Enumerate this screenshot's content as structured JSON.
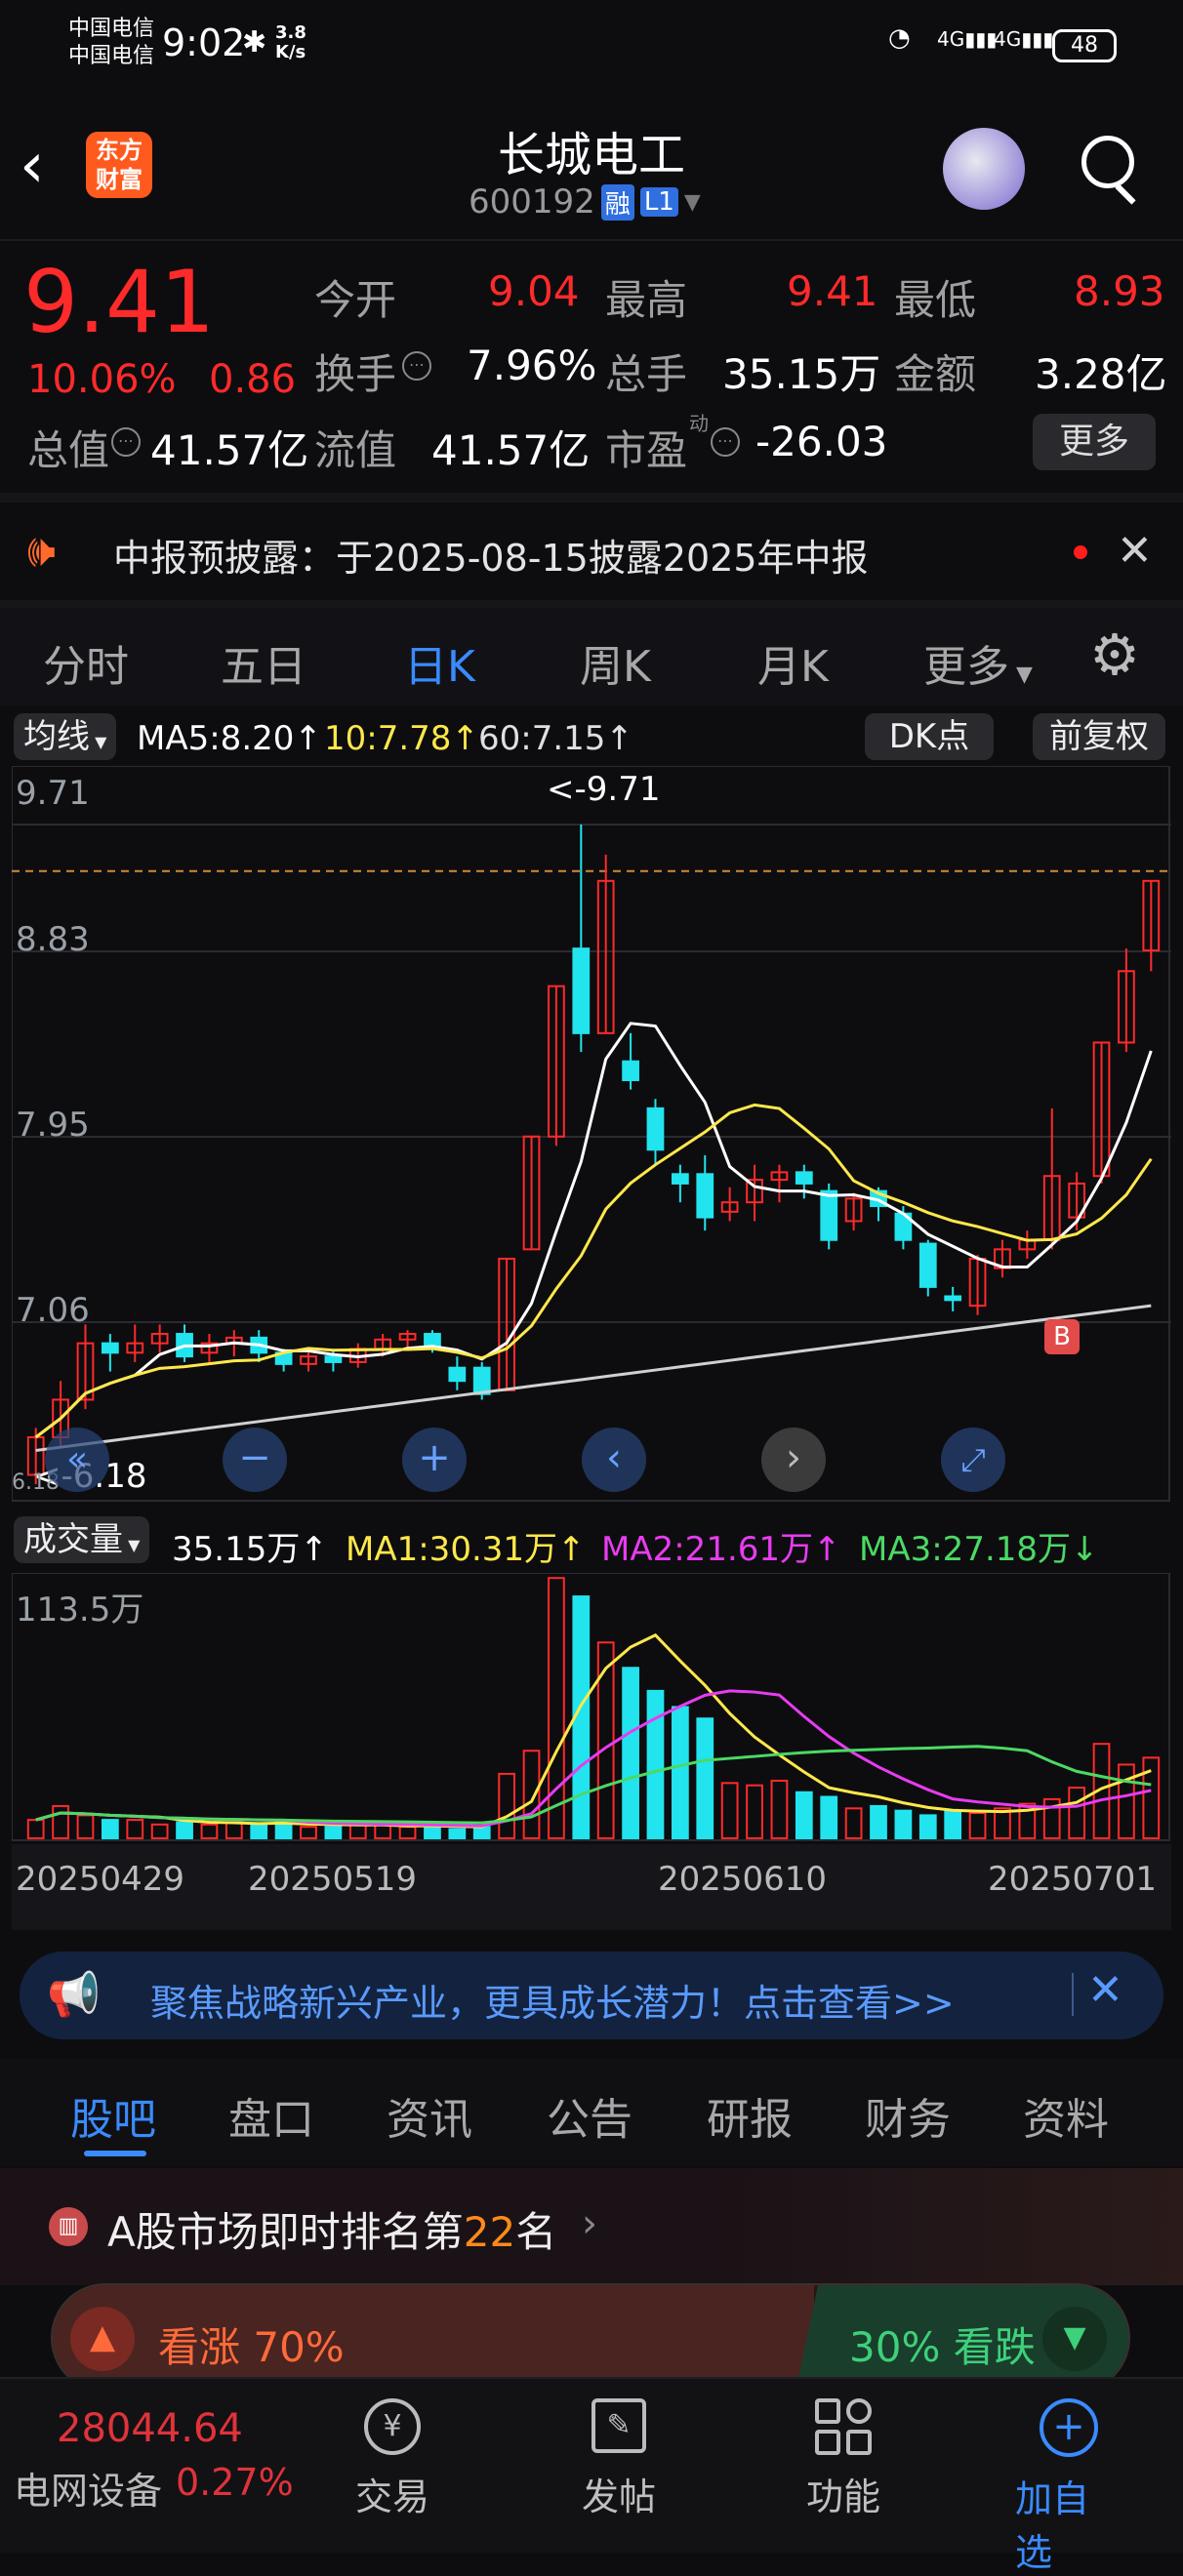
{
  "status_bar": {
    "carrier1": "中国电信",
    "carrier2": "中国电信",
    "time": "9:02",
    "speed_top": "3.8",
    "speed_bottom": "K/s",
    "battery": "48"
  },
  "header": {
    "logo_line1": "东方",
    "logo_line2": "财富",
    "title": "长城电工",
    "code": "600192",
    "badge_margin": "融",
    "badge_level": "L1"
  },
  "quote": {
    "price": "9.41",
    "change_pct": "10.06%",
    "change": "0.86",
    "open_label": "今开",
    "open": "9.04",
    "high_label": "最高",
    "high": "9.41",
    "low_label": "最低",
    "low": "8.93",
    "turnover_label": "换手",
    "turnover": "7.96%",
    "volume_label": "总手",
    "volume": "35.15万",
    "amount_label": "金额",
    "amount": "3.28亿",
    "mktcap_label": "总值",
    "mktcap": "41.57亿",
    "float_label": "流值",
    "float": "41.57亿",
    "pe_label": "市盈",
    "pe_sup": "动",
    "pe": "-26.03",
    "more": "更多"
  },
  "notice": {
    "text": "中报预披露：于2025-08-15披露2025年中报"
  },
  "chart_tabs": [
    "分时",
    "五日",
    "日K",
    "周K",
    "月K",
    "更多"
  ],
  "kline_bar": {
    "indicator": "均线",
    "ma5": "MA5:8.20↑",
    "ma10": "10:7.78↑",
    "ma60": "60:7.15↑",
    "dk": "DK点",
    "adjust": "前复权"
  },
  "kline_axis": {
    "y1": "9.71",
    "y2": "8.83",
    "y3": "7.95",
    "y4": "7.06",
    "y5": "6.18",
    "max_marker": "<-9.71",
    "min_marker": "<-6.18",
    "b_marker": "B"
  },
  "volume_bar": {
    "label": "成交量",
    "vol": "35.15万↑",
    "ma1": "MA1:30.31万↑",
    "ma2": "MA2:21.61万↑",
    "ma3": "MA3:27.18万↓",
    "ymax": "113.5万"
  },
  "dates": [
    "20250429",
    "20250519",
    "20250610",
    "20250701"
  ],
  "chart_data": {
    "type": "candlestick",
    "ylim": [
      6.18,
      9.71
    ],
    "candles": [
      [
        6.25,
        6.45,
        6.2,
        6.5
      ],
      [
        6.45,
        6.65,
        6.4,
        6.75
      ],
      [
        6.65,
        6.95,
        6.6,
        7.05
      ],
      [
        6.95,
        6.9,
        6.8,
        7.0
      ],
      [
        6.9,
        6.95,
        6.85,
        7.05
      ],
      [
        6.95,
        7.0,
        6.9,
        7.05
      ],
      [
        7.0,
        6.88,
        6.85,
        7.05
      ],
      [
        6.9,
        6.95,
        6.85,
        7.0
      ],
      [
        6.95,
        6.98,
        6.88,
        7.02
      ],
      [
        6.98,
        6.9,
        6.85,
        7.02
      ],
      [
        6.9,
        6.84,
        6.8,
        6.92
      ],
      [
        6.84,
        6.88,
        6.8,
        6.92
      ],
      [
        6.88,
        6.85,
        6.8,
        6.92
      ],
      [
        6.85,
        6.92,
        6.82,
        6.95
      ],
      [
        6.92,
        6.97,
        6.88,
        7.0
      ],
      [
        6.97,
        7.0,
        6.92,
        7.02
      ],
      [
        7.0,
        6.93,
        6.9,
        7.02
      ],
      [
        6.82,
        6.75,
        6.7,
        6.88
      ],
      [
        6.82,
        6.68,
        6.65,
        6.85
      ],
      [
        6.7,
        7.4,
        6.7,
        7.4
      ],
      [
        7.45,
        8.05,
        7.45,
        8.05
      ],
      [
        8.05,
        8.85,
        8.0,
        8.85
      ],
      [
        9.05,
        8.6,
        8.5,
        9.71
      ],
      [
        8.6,
        9.41,
        8.6,
        9.55
      ],
      [
        8.45,
        8.35,
        8.3,
        8.6
      ],
      [
        8.2,
        7.98,
        7.9,
        8.25
      ],
      [
        7.85,
        7.8,
        7.7,
        7.9
      ],
      [
        7.85,
        7.62,
        7.55,
        7.95
      ],
      [
        7.65,
        7.7,
        7.6,
        7.78
      ],
      [
        7.7,
        7.82,
        7.6,
        7.9
      ],
      [
        7.82,
        7.86,
        7.7,
        7.9
      ],
      [
        7.86,
        7.8,
        7.72,
        7.9
      ],
      [
        7.76,
        7.5,
        7.45,
        7.8
      ],
      [
        7.6,
        7.72,
        7.55,
        7.75
      ],
      [
        7.76,
        7.68,
        7.6,
        7.78
      ],
      [
        7.64,
        7.5,
        7.45,
        7.68
      ],
      [
        7.48,
        7.25,
        7.2,
        7.5
      ],
      [
        7.2,
        7.18,
        7.12,
        7.25
      ],
      [
        7.15,
        7.4,
        7.1,
        7.42
      ],
      [
        7.35,
        7.45,
        7.3,
        7.5
      ],
      [
        7.45,
        7.5,
        7.4,
        7.55
      ],
      [
        7.5,
        7.84,
        7.45,
        8.2
      ],
      [
        7.62,
        7.8,
        7.55,
        7.86
      ],
      [
        7.84,
        8.55,
        7.8,
        8.55
      ],
      [
        8.55,
        8.93,
        8.5,
        9.05
      ],
      [
        9.04,
        9.41,
        8.93,
        9.41
      ]
    ],
    "volumes": [
      8,
      14,
      10,
      8,
      8,
      6,
      7,
      6,
      7,
      6,
      7,
      5,
      5,
      6,
      6,
      5,
      5,
      4,
      5,
      28,
      38,
      113,
      105,
      85,
      74,
      64,
      57,
      52,
      24,
      23,
      25,
      20,
      18,
      13,
      14,
      12,
      10,
      12,
      11,
      13,
      15,
      17,
      22,
      41,
      32,
      35
    ]
  },
  "promo": {
    "text": "聚焦战略新兴产业，更具成长潜力！点击查看>>"
  },
  "section_tabs": [
    "股吧",
    "盘口",
    "资讯",
    "公告",
    "研报",
    "财务",
    "资料"
  ],
  "ranking": {
    "prefix": "A股市场即时排名第",
    "rank": "22",
    "suffix": "名"
  },
  "sentiment": {
    "bull_label": "看涨 70%",
    "bear_label": "30% 看跌",
    "bull_pct": 70
  },
  "bottom_nav": {
    "index_value": "28044.64",
    "index_name": "电网设备",
    "index_change": "0.27%",
    "trade": "交易",
    "post": "发帖",
    "function": "功能",
    "add": "加自选"
  },
  "colors": {
    "up": "#ff2a2a",
    "down": "#22e4ee",
    "ma5": "#ffffff",
    "ma10": "#ffe84a",
    "ma60": "#d0d0d0",
    "accent": "#3a8bff"
  }
}
